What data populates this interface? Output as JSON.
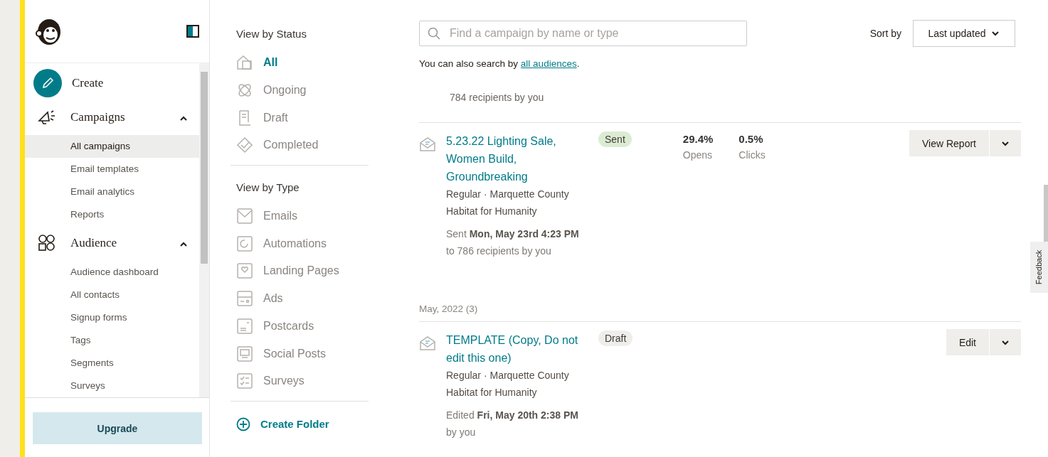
{
  "sidebar": {
    "create": {
      "label": "Create"
    },
    "sections": [
      {
        "label": "Campaigns",
        "kind": "campaigns",
        "expanded": true,
        "children": [
          {
            "label": "All campaigns",
            "selected": true
          },
          {
            "label": "Email templates",
            "selected": false
          },
          {
            "label": "Email analytics",
            "selected": false
          },
          {
            "label": "Reports",
            "selected": false
          }
        ]
      },
      {
        "label": "Audience",
        "kind": "audience",
        "expanded": true,
        "children": [
          {
            "label": "Audience dashboard",
            "selected": false
          },
          {
            "label": "All contacts",
            "selected": false
          },
          {
            "label": "Signup forms",
            "selected": false
          },
          {
            "label": "Tags",
            "selected": false
          },
          {
            "label": "Segments",
            "selected": false
          },
          {
            "label": "Surveys",
            "selected": false
          }
        ]
      }
    ],
    "upgrade_button": "Upgrade"
  },
  "filters": {
    "status_heading": "View by Status",
    "statuses": [
      {
        "label": "All",
        "kind": "all",
        "selected": true
      },
      {
        "label": "Ongoing",
        "kind": "ongoing",
        "selected": false
      },
      {
        "label": "Draft",
        "kind": "draft",
        "selected": false
      },
      {
        "label": "Completed",
        "kind": "completed",
        "selected": false
      }
    ],
    "type_heading": "View by Type",
    "types": [
      {
        "label": "Emails",
        "kind": "emails",
        "selected": false
      },
      {
        "label": "Automations",
        "kind": "automations",
        "selected": false
      },
      {
        "label": "Landing Pages",
        "kind": "landing",
        "selected": false
      },
      {
        "label": "Ads",
        "kind": "ads",
        "selected": false
      },
      {
        "label": "Postcards",
        "kind": "postcards",
        "selected": false
      },
      {
        "label": "Social Posts",
        "kind": "social",
        "selected": false
      },
      {
        "label": "Surveys",
        "kind": "surveys",
        "selected": false
      }
    ],
    "create_folder": "Create Folder"
  },
  "search": {
    "placeholder": "Find a campaign by name or type"
  },
  "search_hint": {
    "text": "You can also search by",
    "link": "all audiences",
    "end": "."
  },
  "sort": {
    "label": "Sort by",
    "value": "Last updated"
  },
  "partial_row": {
    "recipients": "784 recipients by you"
  },
  "groups": [
    {
      "campaigns": [
        {
          "title": "5.23.22 Lighting Sale, Women Build, Groundbreaking",
          "meta": "Regular · Marquette County Habitat for Humanity",
          "date": "Sent **Mon, May 23rd 4:23 PM**",
          "by": "to 786 recipients by you",
          "status": {
            "label": "Sent",
            "kind": "sent"
          },
          "stats": [
            {
              "value": "29.4%",
              "label": "Opens"
            },
            {
              "value": "0.5%",
              "label": "Clicks"
            }
          ],
          "action": "View Report"
        }
      ]
    },
    {
      "heading": "May, 2022 (3)",
      "campaigns": [
        {
          "title": "TEMPLATE (Copy, Do not edit this one)",
          "meta": "Regular · Marquette County Habitat for Humanity",
          "date": "Edited **Fri, May 20th 2:38 PM**",
          "by": "by you",
          "status": {
            "label": "Draft",
            "kind": "draft"
          },
          "action": "Edit"
        }
      ]
    }
  ],
  "feedback_tab": "Feedback"
}
